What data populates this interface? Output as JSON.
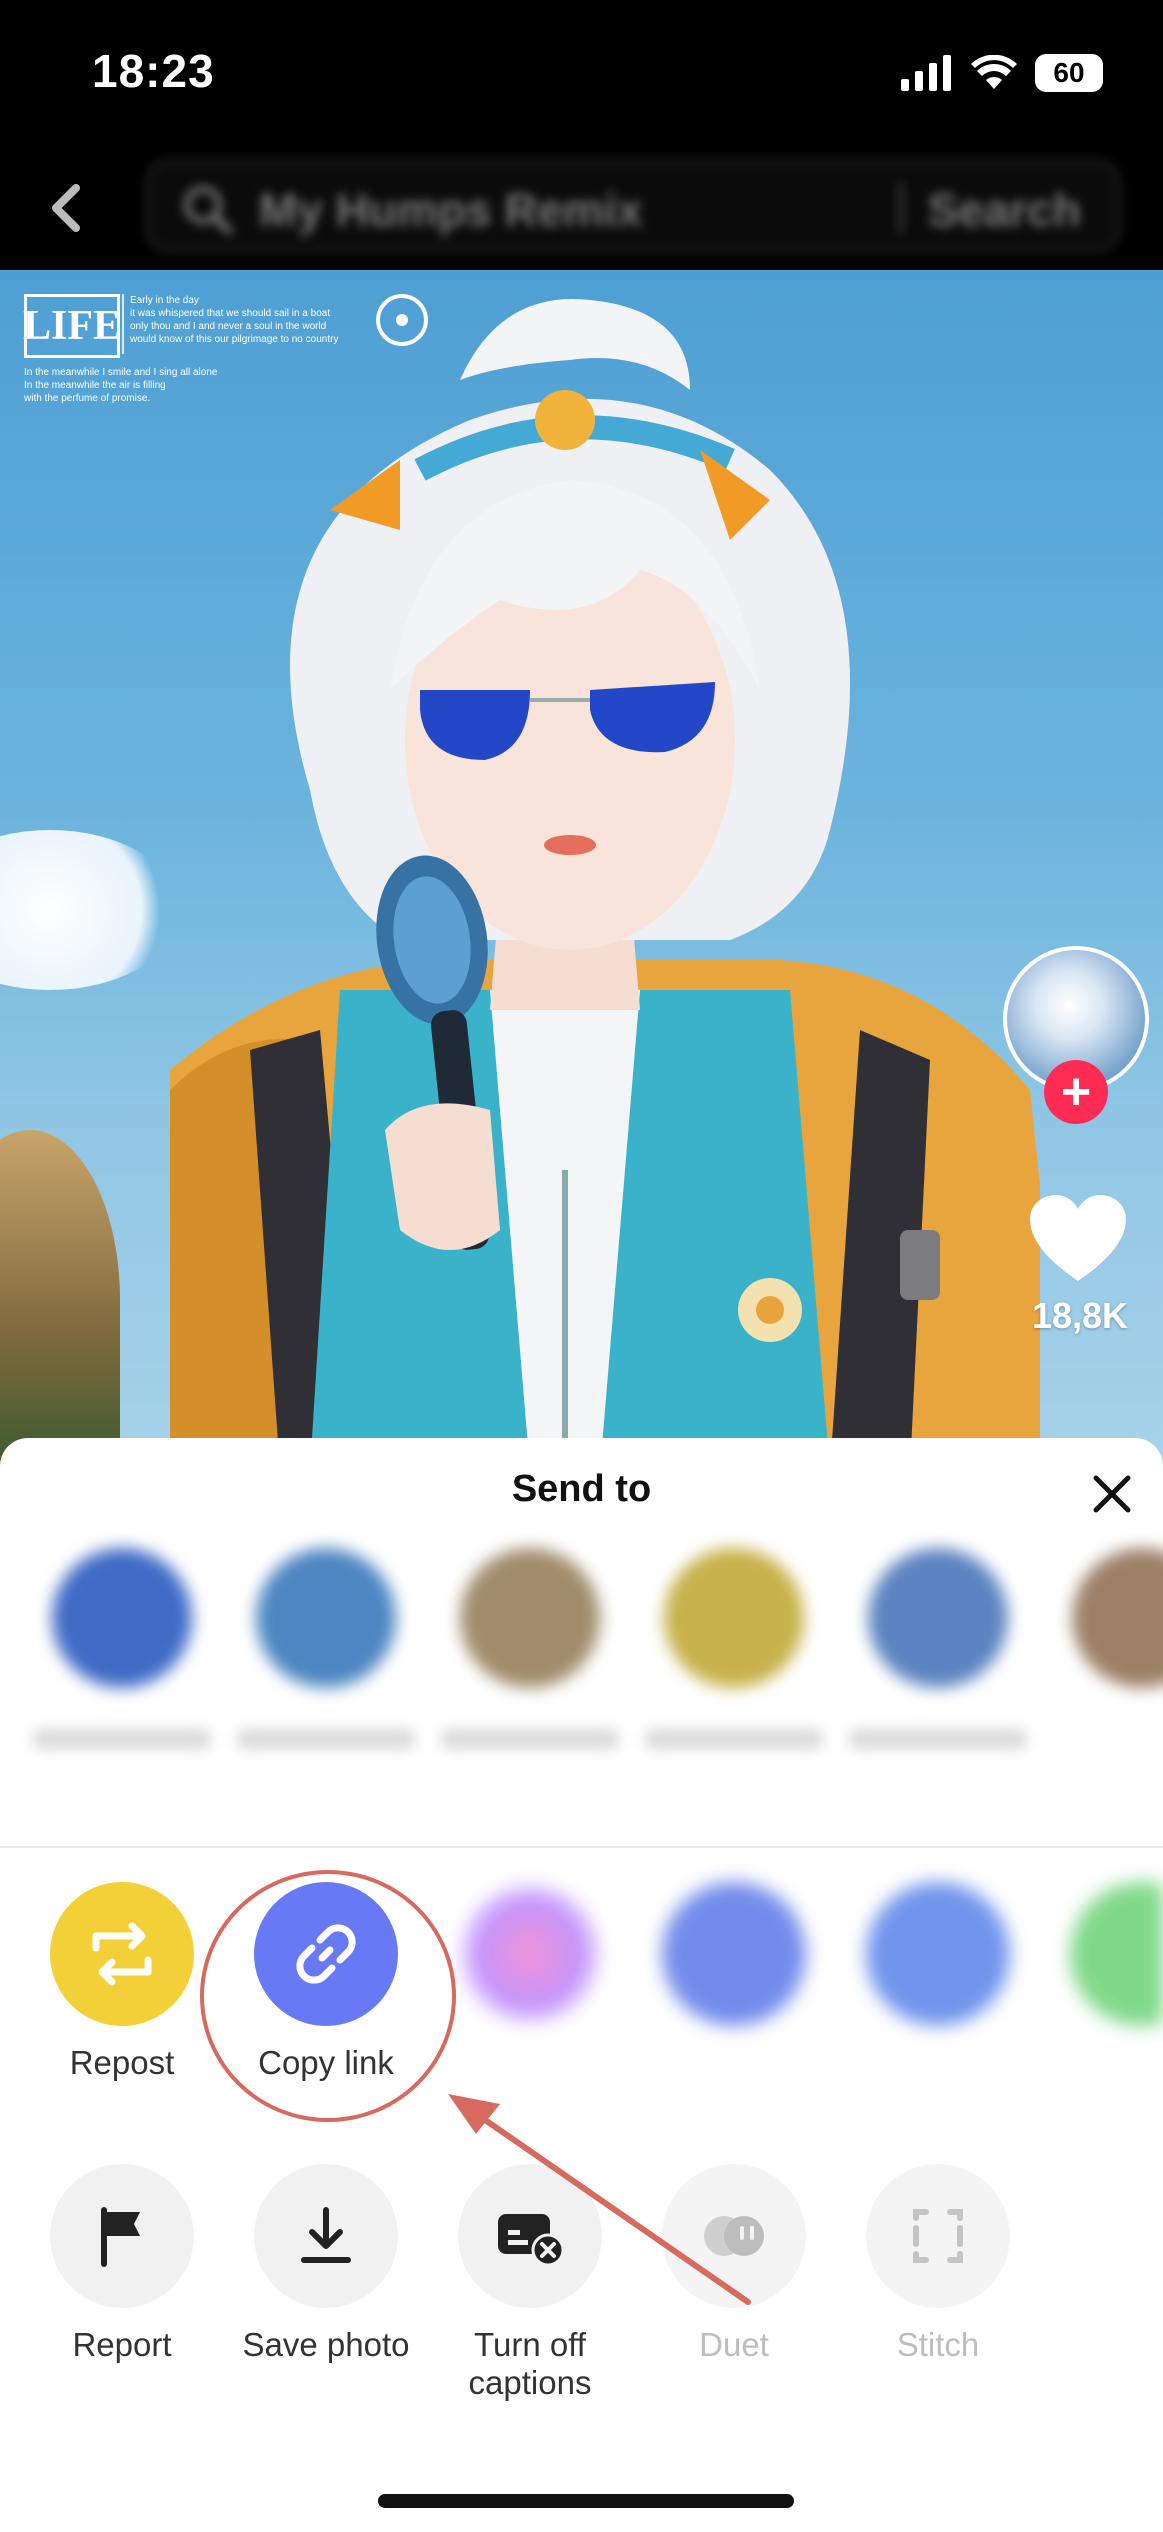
{
  "status_bar": {
    "time": "18:23",
    "battery": "60"
  },
  "header": {
    "search_term": "My Humps Remix",
    "search_button": "Search"
  },
  "video": {
    "overlay_logo": "LIFE",
    "overlay_text": "Early in the day\nit was whispered that we should sail in a boat\nonly thou and I and never a soul in the world\nwould know of this our pilgrimage to no country",
    "overlay_subtext": "In the meanwhile I smile and I sing all alone\nIn the meanwhile the air is filling\nwith the perfume of promise.",
    "likes": "18,8K"
  },
  "share_sheet": {
    "title": "Send to",
    "contacts": [
      {
        "color": "#3f6bc6"
      },
      {
        "color": "#4d86c2"
      },
      {
        "color": "#a08c6a"
      },
      {
        "color": "#c7b14a"
      },
      {
        "color": "#5b84c0"
      },
      {
        "color": "#9c8066"
      }
    ],
    "share_row": [
      {
        "label": "Repost",
        "icon": "repost-icon",
        "color": "#f3cf38"
      },
      {
        "label": "Copy link",
        "icon": "link-icon",
        "color": "#6779f5"
      }
    ],
    "action_row": [
      {
        "label": "Report",
        "icon": "flag-icon",
        "enabled": true
      },
      {
        "label": "Save photo",
        "icon": "download-icon",
        "enabled": true
      },
      {
        "label": "Turn off captions",
        "icon": "captions-off-icon",
        "enabled": true
      },
      {
        "label": "Duet",
        "icon": "duet-icon",
        "enabled": false
      },
      {
        "label": "Stitch",
        "icon": "stitch-icon",
        "enabled": false
      }
    ]
  },
  "colors": {
    "accent_red": "#fe2c55",
    "annotation": "#d66a5f"
  }
}
